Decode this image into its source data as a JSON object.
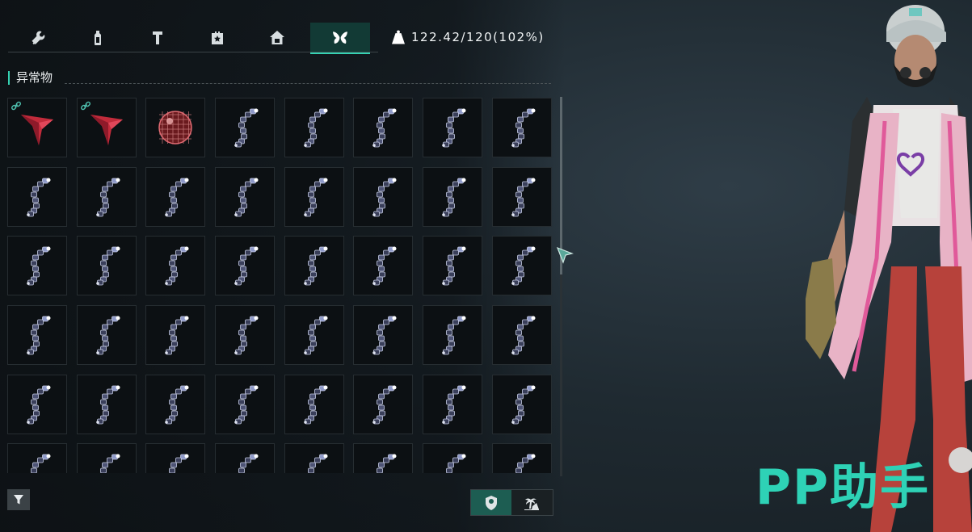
{
  "tabs": [
    {
      "icon": "wrench-icon",
      "name": "tab-tools"
    },
    {
      "icon": "bottle-icon",
      "name": "tab-consumables"
    },
    {
      "icon": "hammer-icon",
      "name": "tab-materials"
    },
    {
      "icon": "star-box-icon",
      "name": "tab-special"
    },
    {
      "icon": "house-icon",
      "name": "tab-building"
    },
    {
      "icon": "butterfly-icon",
      "name": "tab-anomaly",
      "active": true
    }
  ],
  "weight": {
    "icon": "weight-icon",
    "text": "122.42/120(102%)"
  },
  "section": {
    "title": "异常物"
  },
  "grid": {
    "columns": 8,
    "rows": [
      [
        "red-arrowhead-linked",
        "red-arrowhead-linked",
        "disco-ball",
        "chain-link",
        "chain-link",
        "chain-link",
        "chain-link",
        "chain-link"
      ],
      [
        "chain-link",
        "chain-link",
        "chain-link",
        "chain-link",
        "chain-link",
        "chain-link",
        "chain-link",
        "chain-link"
      ],
      [
        "chain-link",
        "chain-link",
        "chain-link",
        "chain-link",
        "chain-link",
        "chain-link",
        "chain-link",
        "chain-link"
      ],
      [
        "chain-link",
        "chain-link",
        "chain-link",
        "chain-link",
        "chain-link",
        "chain-link",
        "chain-link",
        "chain-link"
      ],
      [
        "chain-link",
        "chain-link",
        "chain-link",
        "chain-link",
        "chain-link",
        "chain-link",
        "chain-link",
        "chain-link"
      ],
      [
        "chain-link",
        "chain-link",
        "chain-link",
        "chain-link",
        "chain-link",
        "chain-link",
        "chain-link",
        "chain-link"
      ]
    ]
  },
  "footer": {
    "filter_icon": "filter-icon",
    "toggle": [
      {
        "icon": "badge-icon",
        "active": true
      },
      {
        "icon": "island-icon",
        "active": false
      }
    ]
  },
  "watermark": {
    "text": "PP助手"
  },
  "colors": {
    "accent": "#35d2b2",
    "tab_active_bg": "#123a35",
    "watermark": "#2ed2b6"
  }
}
